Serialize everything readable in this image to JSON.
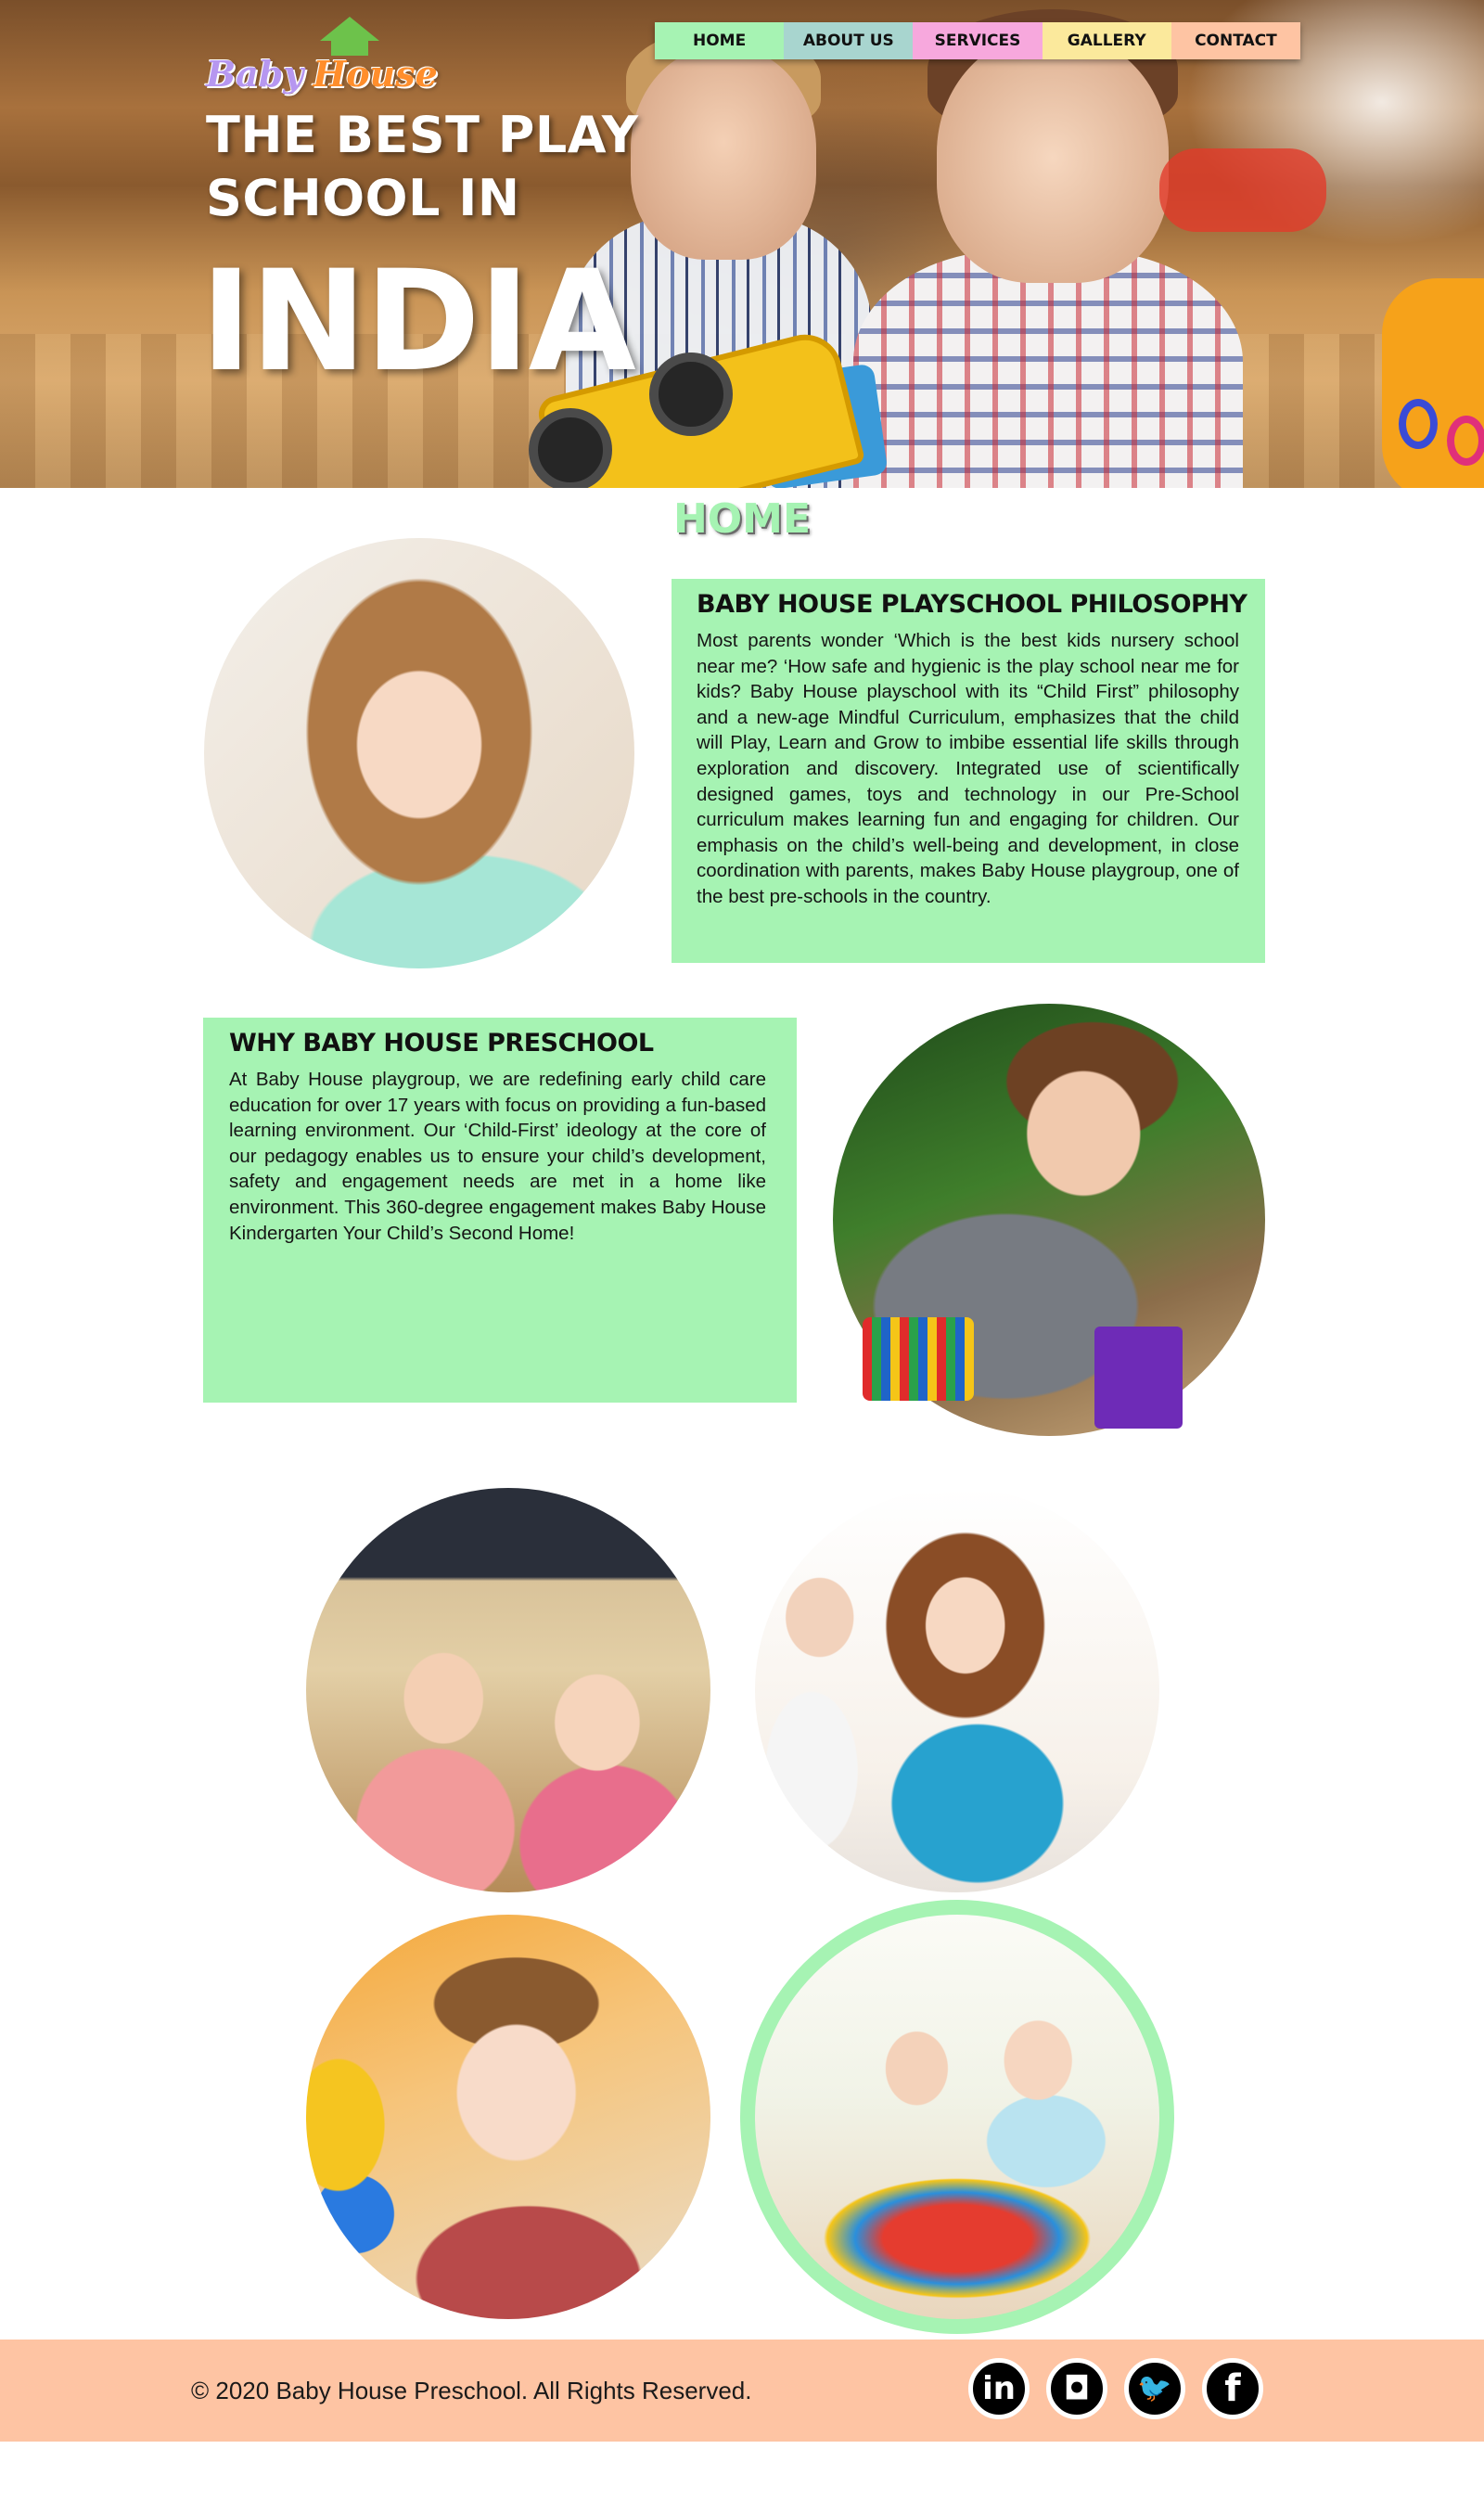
{
  "brand": {
    "logo_part1": "Baby",
    "logo_part2": "House"
  },
  "nav": {
    "items": [
      {
        "label": "HOME",
        "color": "#a6f3b3"
      },
      {
        "label": "ABOUT US",
        "color": "#a8d5cf"
      },
      {
        "label": "SERVICES",
        "color": "#f7a8dd"
      },
      {
        "label": "GALLERY",
        "color": "#fbe99c"
      },
      {
        "label": "CONTACT",
        "color": "#fec4a3"
      }
    ]
  },
  "hero": {
    "line1": "THE BEST PLAY",
    "line2": "SCHOOL IN",
    "big": "INDIA"
  },
  "page_heading": "HOME",
  "philosophy": {
    "title": "BABY HOUSE PLAYSCHOOL PHILOSOPHY",
    "text": "Most parents wonder ‘Which is the best kids nursery school near me? ‘How safe and hygienic is the play school near me for kids? Baby House playschool with its “Child First” philosophy and a new-age Mindful Curriculum, emphasizes that the child will Play, Learn and Grow to imbibe essential life skills through exploration and discovery. Integrated use of scientifically designed games, toys and technology in our Pre-School curriculum makes learning fun and engaging for children. Our emphasis on the child’s well-being and development, in close coordination with parents, makes Baby House playgroup, one of the best pre-schools in the country."
  },
  "why": {
    "title": "WHY BABY HOUSE PRESCHOOL",
    "text": "At Baby House playgroup, we are redefining early child care education for over 17 years with focus on providing a fun-based learning environment. Our ‘Child-First’ ideology at the core of our pedagogy enables us to ensure your child’s development, safety and engagement needs are met in a home like environment. This 360-degree engagement makes Baby House Kindergarten Your Child’s Second Home!"
  },
  "footer": {
    "copyright": "© 2020 Baby House Preschool. All Rights Reserved.",
    "social": [
      {
        "icon": "linkedin-icon",
        "glyph": "in"
      },
      {
        "icon": "instagram-icon",
        "glyph": "◘"
      },
      {
        "icon": "twitter-icon",
        "glyph": "🐦"
      },
      {
        "icon": "facebook-icon",
        "glyph": "f"
      }
    ]
  },
  "colors": {
    "accent_green": "#a6f3b3",
    "footer_peach": "#fec4a3",
    "logo_purple": "#b697f0",
    "logo_orange": "#ff8e2c"
  }
}
